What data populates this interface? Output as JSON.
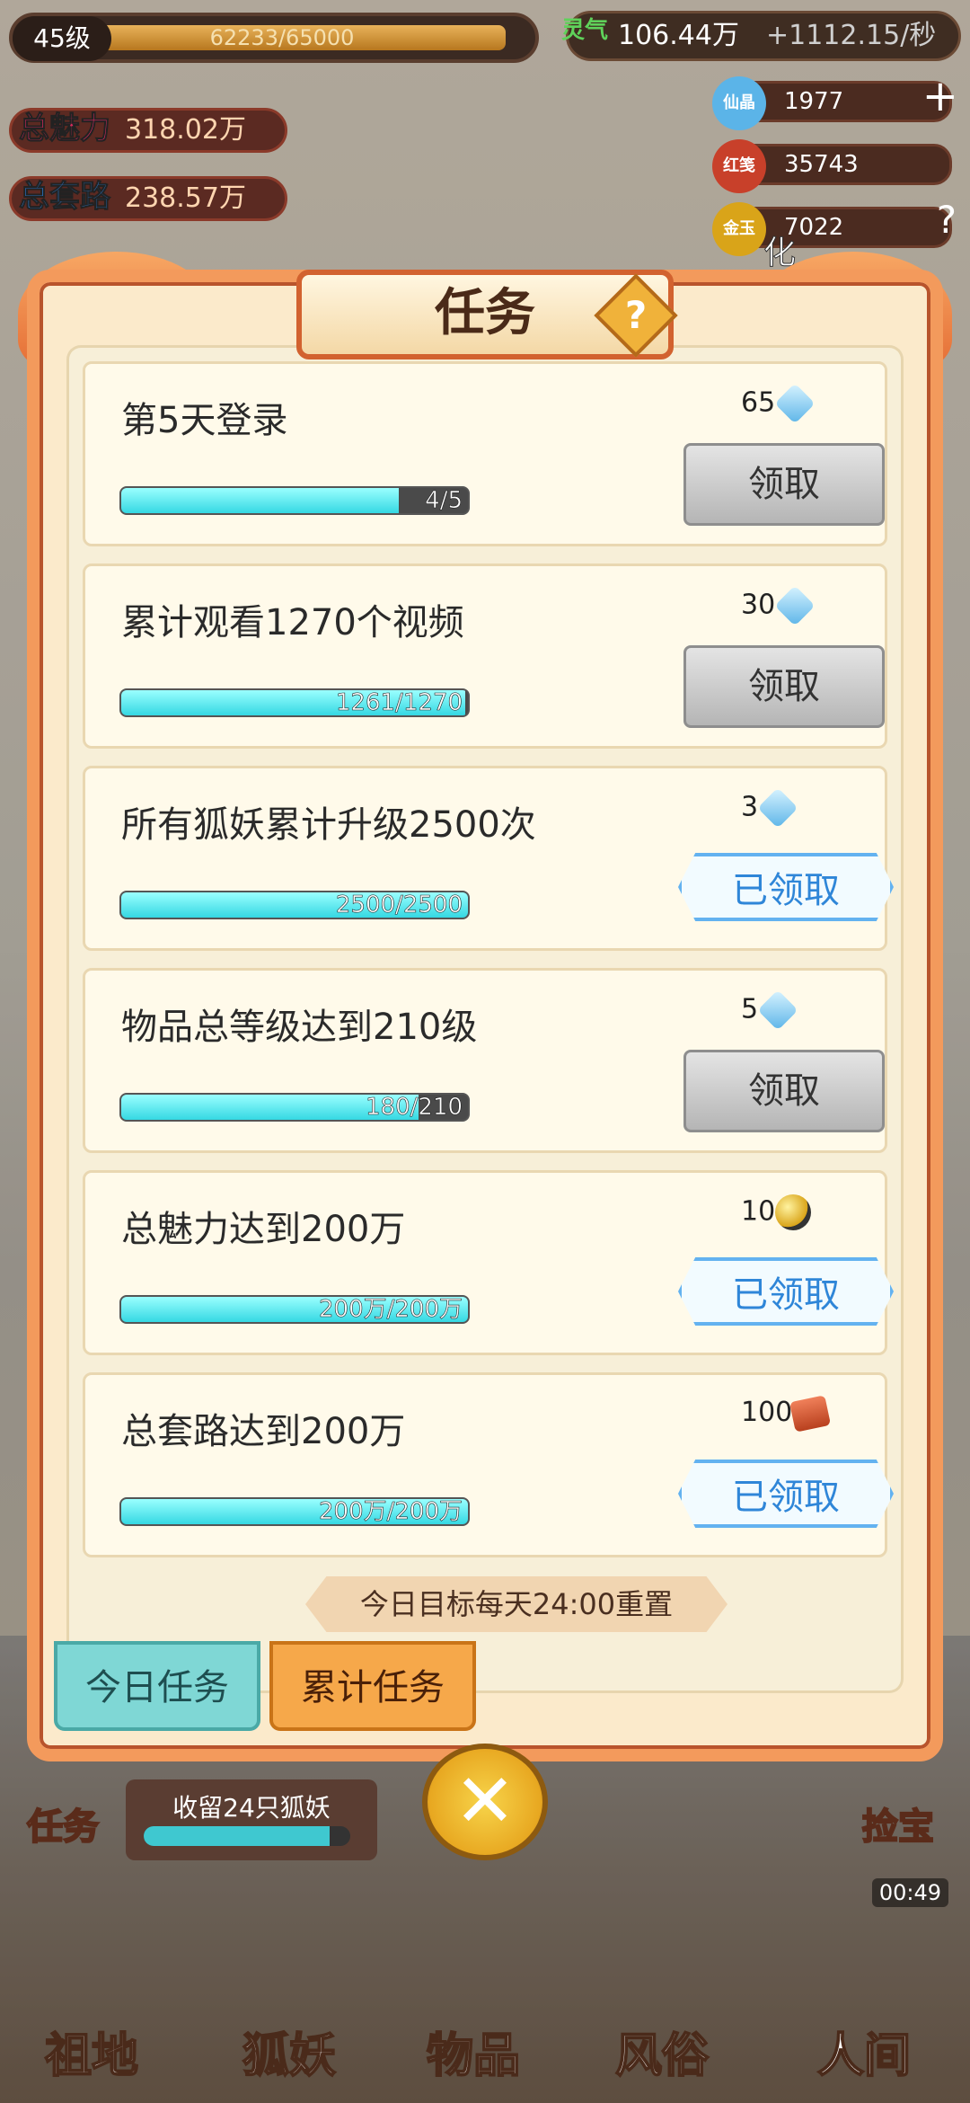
{
  "hud": {
    "level": "45级",
    "exp": "62233/65000",
    "exp_fraction": 0.957,
    "charm_label": "总魅力",
    "charm_value": "318.02万",
    "trick_label": "总套路",
    "trick_value": "238.57万",
    "lingqi_label": "灵气",
    "lingqi_value": "106.44万",
    "lingqi_rate": "+1112.15/秒",
    "res": [
      {
        "icon": "gem-icon",
        "label": "仙晶",
        "value": "1977",
        "color": "#5bb4e8"
      },
      {
        "icon": "red-paper-icon",
        "label": "红笺",
        "value": "35743",
        "color": "#c8402a"
      },
      {
        "icon": "coin-icon",
        "label": "金玉",
        "value": "7022",
        "color": "#d9a419"
      }
    ],
    "side_right_label": "化形"
  },
  "dialog": {
    "title": "任务",
    "tasks": [
      {
        "title": "第5天登录",
        "progress_text": "4/5",
        "progress": 0.8,
        "reward": "65",
        "reward_icon": "gem-icon",
        "button": "领取",
        "claimed": false
      },
      {
        "title": "累计观看1270个视频",
        "progress_text": "1261/1270",
        "progress": 0.993,
        "reward": "30",
        "reward_icon": "gem-icon",
        "button": "领取",
        "claimed": false
      },
      {
        "title": "所有狐妖累计升级2500次",
        "progress_text": "2500/2500",
        "progress": 1.0,
        "reward": "3",
        "reward_icon": "gem-icon",
        "button": "已领取",
        "claimed": true
      },
      {
        "title": "物品总等级达到210级",
        "progress_text": "180/210",
        "progress": 0.857,
        "reward": "5",
        "reward_icon": "gem-icon",
        "button": "领取",
        "claimed": false
      },
      {
        "title": "总魅力达到200万",
        "progress_text": "200万/200万",
        "progress": 1.0,
        "reward": "10",
        "reward_icon": "coin-icon",
        "button": "已领取",
        "claimed": true
      },
      {
        "title": "总套路达到200万",
        "progress_text": "200万/200万",
        "progress": 1.0,
        "reward": "100",
        "reward_icon": "red-paper-icon",
        "button": "已领取",
        "claimed": true
      }
    ],
    "reset_note": "今日目标每天24:00重置",
    "tabs": {
      "today": "今日任务",
      "total": "累计任务"
    }
  },
  "bottom": {
    "collect_text": "收留24只狐妖",
    "collect_progress": 0.9,
    "left_button": "任务",
    "right_button": "捡宝",
    "timer": "00:49",
    "nav": [
      "祖地",
      "狐妖",
      "物品",
      "风俗",
      "人间"
    ]
  }
}
